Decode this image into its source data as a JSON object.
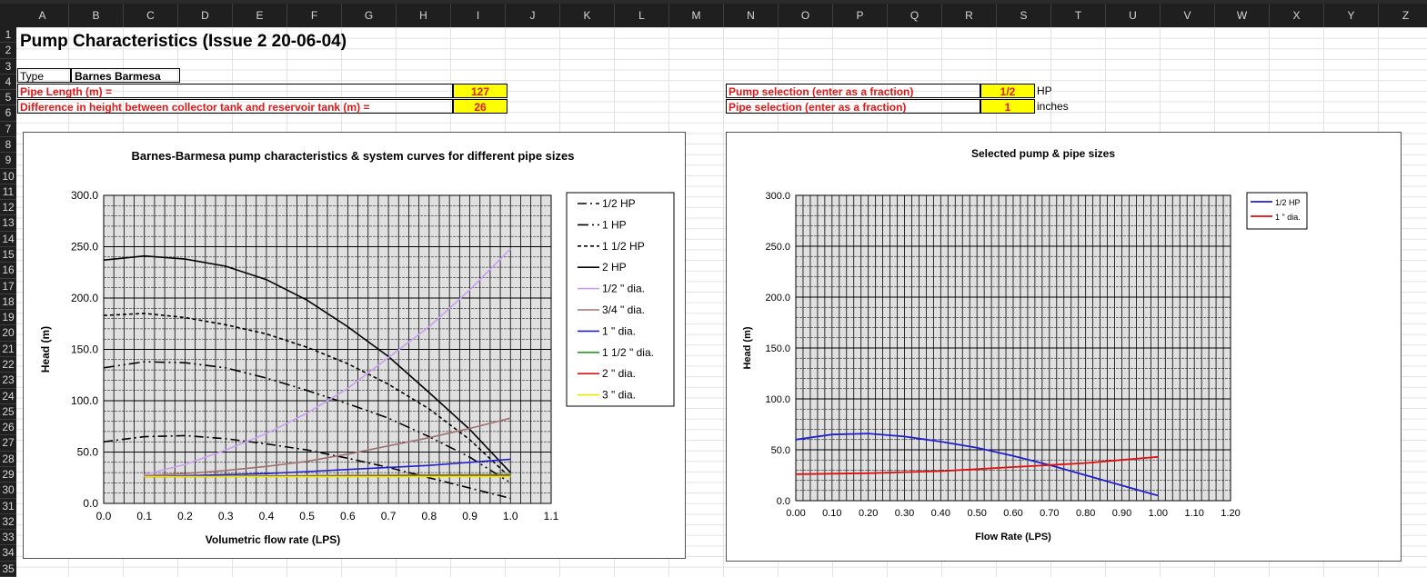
{
  "columns": [
    "A",
    "B",
    "C",
    "D",
    "E",
    "F",
    "G",
    "H",
    "I",
    "J",
    "K",
    "L",
    "M",
    "N",
    "O",
    "P",
    "Q",
    "R",
    "S",
    "T",
    "U",
    "V",
    "W",
    "X",
    "Y",
    "Z"
  ],
  "rows": [
    "1",
    "2",
    "3",
    "4",
    "5",
    "6",
    "7",
    "8",
    "9",
    "10",
    "11",
    "12",
    "13",
    "14",
    "15",
    "16",
    "17",
    "18",
    "19",
    "20",
    "21",
    "22",
    "23",
    "24",
    "25",
    "26",
    "27",
    "28",
    "29",
    "30",
    "31",
    "32",
    "33",
    "34",
    "35"
  ],
  "sheet": {
    "title": "Pump Characteristics (Issue 2 20-06-04)",
    "type_label": "Type",
    "type_value": "Barnes Barmesa",
    "pipe_length_label": "Pipe Length (m) =",
    "pipe_length_value": "127",
    "height_diff_label": "Difference in height between collector tank and reservoir tank (m) =",
    "height_diff_value": "26",
    "pump_sel_label": "Pump selection (enter as a fraction)",
    "pump_sel_value": "1/2",
    "pump_sel_unit": "HP",
    "pipe_sel_label": "Pipe selection (enter as a fraction)",
    "pipe_sel_value": "1",
    "pipe_sel_unit": "inches"
  },
  "chart_data": [
    {
      "type": "line",
      "title": "Barnes-Barmesa pump characteristics & system curves for different pipe sizes",
      "xlabel": "Volumetric flow rate (LPS)",
      "ylabel": "Head (m)",
      "xlim": [
        0,
        1.1
      ],
      "ylim": [
        0,
        300
      ],
      "xticks": [
        "0.0",
        "0.1",
        "0.2",
        "0.3",
        "0.4",
        "0.5",
        "0.6",
        "0.7",
        "0.8",
        "0.9",
        "1.0",
        "1.1"
      ],
      "yticks": [
        "0.0",
        "50.0",
        "100.0",
        "150.0",
        "200.0",
        "250.0",
        "300.0"
      ],
      "grid": true,
      "legend": "right",
      "series": [
        {
          "name": "1/2 HP",
          "color": "#000000",
          "dash": "10,4,2,4",
          "x": [
            0,
            0.1,
            0.2,
            0.3,
            0.4,
            0.5,
            0.6,
            0.7,
            0.8,
            0.9,
            1.0
          ],
          "y": [
            60,
            65,
            66,
            63,
            58,
            52,
            44,
            35,
            25,
            15,
            5
          ]
        },
        {
          "name": "1 HP",
          "color": "#000000",
          "dash": "12,4,2,4,2,4",
          "x": [
            0,
            0.1,
            0.2,
            0.3,
            0.4,
            0.5,
            0.6,
            0.7,
            0.8,
            0.9,
            1.0
          ],
          "y": [
            132,
            138,
            137,
            132,
            122,
            110,
            97,
            83,
            65,
            45,
            20
          ]
        },
        {
          "name": "1 1/2 HP",
          "color": "#000000",
          "dash": "4,3",
          "x": [
            0,
            0.1,
            0.2,
            0.3,
            0.4,
            0.5,
            0.6,
            0.7,
            0.8,
            0.9,
            1.0
          ],
          "y": [
            183,
            185,
            181,
            174,
            165,
            152,
            136,
            116,
            92,
            62,
            25
          ]
        },
        {
          "name": "2 HP",
          "color": "#000000",
          "dash": "",
          "x": [
            0,
            0.1,
            0.2,
            0.3,
            0.4,
            0.5,
            0.6,
            0.7,
            0.8,
            0.9,
            1.0
          ],
          "y": [
            237,
            241,
            238,
            231,
            218,
            198,
            172,
            143,
            108,
            72,
            30
          ]
        },
        {
          "name": "1/2 \" dia.",
          "color": "#c8a0f0",
          "dash": "",
          "x": [
            0.1,
            0.2,
            0.3,
            0.4,
            0.5,
            0.6,
            0.7,
            0.8,
            0.9,
            1.0
          ],
          "y": [
            28,
            38,
            52,
            68,
            88,
            112,
            142,
            172,
            208,
            248
          ]
        },
        {
          "name": "3/4 \" dia.",
          "color": "#a07070",
          "dash": "",
          "x": [
            0.1,
            0.2,
            0.3,
            0.4,
            0.5,
            0.6,
            0.7,
            0.8,
            0.9,
            1.0
          ],
          "y": [
            27,
            29,
            32,
            36,
            41,
            48,
            56,
            64,
            73,
            83
          ]
        },
        {
          "name": "1 \" dia.",
          "color": "#2020d0",
          "dash": "",
          "x": [
            0.1,
            0.2,
            0.3,
            0.4,
            0.5,
            0.6,
            0.7,
            0.8,
            0.9,
            1.0
          ],
          "y": [
            26,
            27,
            28,
            29,
            31,
            33,
            35,
            37,
            40,
            43
          ]
        },
        {
          "name": "1 1/2 \" dia.",
          "color": "#20a020",
          "dash": "",
          "x": [
            0.1,
            0.5,
            1.0
          ],
          "y": [
            26,
            27,
            28
          ]
        },
        {
          "name": "2 \" dia.",
          "color": "#e01010",
          "dash": "",
          "x": [
            0.1,
            0.5,
            1.0
          ],
          "y": [
            26,
            26.5,
            27
          ]
        },
        {
          "name": "3 \" dia.",
          "color": "#e8e800",
          "dash": "",
          "x": [
            0.1,
            0.5,
            1.0
          ],
          "y": [
            26,
            26,
            26.2
          ]
        }
      ]
    },
    {
      "type": "line",
      "title": "Selected pump & pipe sizes",
      "xlabel": "Flow Rate (LPS)",
      "ylabel": "Head (m)",
      "xlim": [
        0,
        1.2
      ],
      "ylim": [
        0,
        300
      ],
      "xticks": [
        "0.00",
        "0.10",
        "0.20",
        "0.30",
        "0.40",
        "0.50",
        "0.60",
        "0.70",
        "0.80",
        "0.90",
        "1.00",
        "1.10",
        "1.20"
      ],
      "yticks": [
        "0.0",
        "50.0",
        "100.0",
        "150.0",
        "200.0",
        "250.0",
        "300.0"
      ],
      "grid": true,
      "legend": "top-right",
      "series": [
        {
          "name": "1/2 HP",
          "color": "#2020d0",
          "dash": "",
          "x": [
            0,
            0.1,
            0.2,
            0.3,
            0.4,
            0.5,
            0.6,
            0.7,
            0.8,
            0.9,
            1.0
          ],
          "y": [
            60,
            65,
            66,
            63,
            58,
            52,
            44,
            35,
            25,
            15,
            5
          ]
        },
        {
          "name": "1 \" dia.",
          "color": "#e01010",
          "dash": "",
          "x": [
            0,
            0.1,
            0.2,
            0.3,
            0.4,
            0.5,
            0.6,
            0.7,
            0.8,
            0.9,
            1.0
          ],
          "y": [
            26,
            26.5,
            27,
            28,
            29,
            31,
            33,
            35,
            37,
            40,
            43
          ]
        }
      ]
    }
  ]
}
